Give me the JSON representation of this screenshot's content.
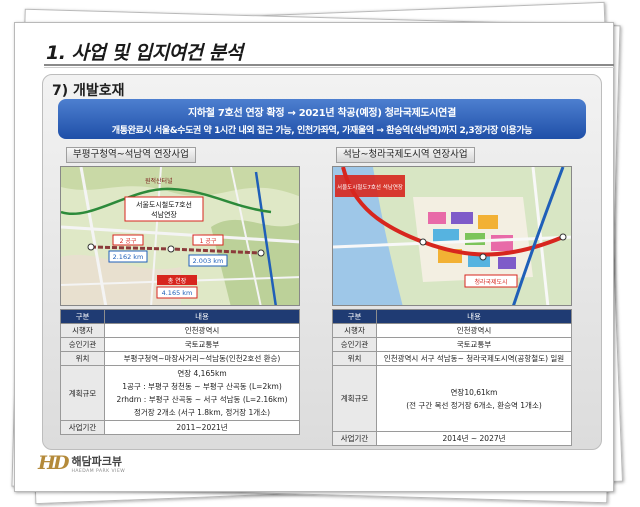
{
  "page_title": "1. 사업 및 입지여건 분석",
  "section_title": "7) 개발호재",
  "banner": {
    "line1": "지하철 7호선 연장 확정 → 2021년 착공(예정) 청라국제도시연결",
    "line2": "개통완료시 서울&수도권 약 1시간 내외 접근 가능, 인천가좌역, 가재울역 → 환승역(석남역)까지 2,3정거장 이용가능"
  },
  "left": {
    "heading": "부평구청역~석남역 연장사업",
    "map_labels": {
      "title_box_line1": "서울도시철도7호선",
      "title_box_line2": "석남연장",
      "area": "원적산터널",
      "zone2": "2 공구",
      "zone2_km": "2.162 km",
      "zone1": "1 공구",
      "zone1_km": "2.003 km",
      "total": "총 연장",
      "total_km": "4.165 km"
    },
    "table": {
      "headers": [
        "구분",
        "내용"
      ],
      "rows": [
        {
          "k": "시행자",
          "v": [
            "인천광역시"
          ]
        },
        {
          "k": "승인기관",
          "v": [
            "국토교통부"
          ]
        },
        {
          "k": "위치",
          "v": [
            "부평구청역~마장사거리~석남동(인천2호선 환승)"
          ]
        },
        {
          "k": "계획규모",
          "v": [
            "연장 4,165km",
            "1공구 : 부평구 청천동 ~ 부평구 산곡동 (L=2km)",
            "2rhdrn : 부평구 산곡동 ~ 서구 석남동 (L=2.16km)",
            "정거장 2개소 (서구 1.8km, 정거장 1개소)"
          ]
        },
        {
          "k": "사업기간",
          "v": [
            "2011~2021년"
          ]
        }
      ]
    }
  },
  "right": {
    "heading": "석남~청라국제도시역 연장사업",
    "map_labels": {
      "box1": "서울도시철도7호선 석남연장",
      "box2": "청라국제도시"
    },
    "table": {
      "headers": [
        "구분",
        "내용"
      ],
      "rows": [
        {
          "k": "시행자",
          "v": [
            "인천광역시"
          ]
        },
        {
          "k": "승인기관",
          "v": [
            "국토교통부"
          ]
        },
        {
          "k": "위치",
          "v": [
            "인천광역시 서구 석남동~ 청라국제도시역(공항철도) 일원"
          ]
        },
        {
          "k": "계획규모",
          "v": [
            "연장10,61km",
            "(전 구간 복선 정거장 6개소, 환승역 1개소)"
          ]
        },
        {
          "k": "사업기간",
          "v": [
            "2014년 ~ 2027년"
          ]
        }
      ]
    }
  },
  "logo": {
    "mark": "HD",
    "name_kr": "해담파크뷰",
    "name_en": "HAEDAM PARK VIEW"
  },
  "colors": {
    "banner": "#2a5bb5",
    "table_header": "#1f3b73",
    "route_red": "#d7261e",
    "route_green": "#2c8a3a"
  }
}
